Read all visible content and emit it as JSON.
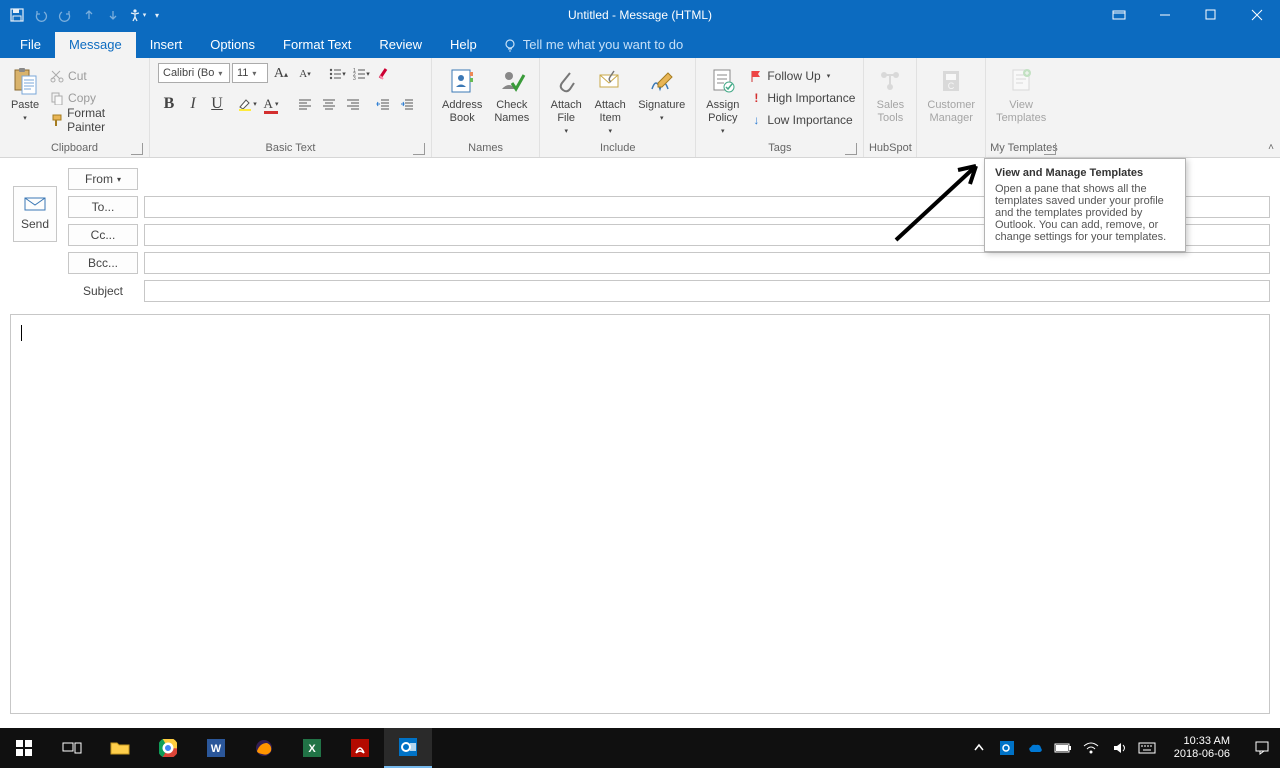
{
  "titlebar": {
    "title": "Untitled  -  Message (HTML)"
  },
  "tabs": {
    "file": "File",
    "message": "Message",
    "insert": "Insert",
    "options": "Options",
    "format": "Format Text",
    "review": "Review",
    "help": "Help",
    "tellme": "Tell me what you want to do"
  },
  "ribbon": {
    "clipboard": {
      "label": "Clipboard",
      "paste": "Paste",
      "cut": "Cut",
      "copy": "Copy",
      "format_painter": "Format Painter"
    },
    "basictext": {
      "label": "Basic Text",
      "font": "Calibri (Bo",
      "size": "11"
    },
    "names": {
      "label": "Names",
      "address_book": "Address\nBook",
      "check_names": "Check\nNames"
    },
    "include": {
      "label": "Include",
      "attach_file": "Attach\nFile",
      "attach_item": "Attach\nItem",
      "signature": "Signature"
    },
    "tags": {
      "label": "Tags",
      "assign_policy": "Assign\nPolicy",
      "follow_up": "Follow Up",
      "high": "High Importance",
      "low": "Low Importance"
    },
    "hubspot": {
      "label": "HubSpot",
      "sales_tools": "Sales\nTools"
    },
    "cust_mgr": "Customer\nManager",
    "my_templates": {
      "label": "My Templates",
      "view_templates": "View\nTemplates"
    }
  },
  "compose": {
    "send": "Send",
    "from": "From",
    "to": "To...",
    "cc": "Cc...",
    "bcc": "Bcc...",
    "subject": "Subject"
  },
  "tooltip": {
    "title": "View and Manage Templates",
    "body": "Open a pane that shows all the templates saved under your profile and the templates provided by Outlook. You can add, remove, or change settings for your templates."
  },
  "taskbar": {
    "time": "10:33 AM",
    "date": "2018-06-06"
  }
}
